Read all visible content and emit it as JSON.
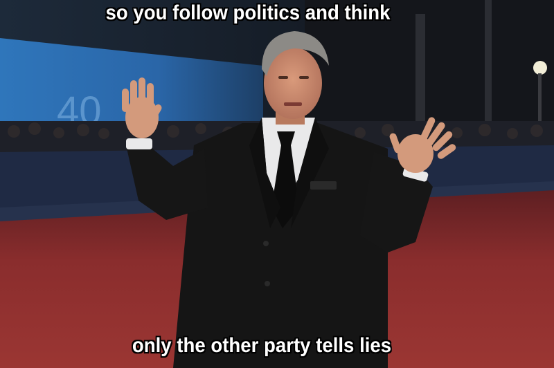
{
  "meme": {
    "top_text": "so you follow politics and think",
    "bottom_text": "only the other party tells lies"
  },
  "photo": {
    "subject": "man in black suit with raised open hands",
    "background_sign_text": "40",
    "colors": {
      "carpet": "#8e2f2e",
      "banner": "#2a6fb5",
      "suit": "#141414",
      "shirt": "#e9e9ea",
      "skin": "#c98a6c",
      "hair": "#8c8a86"
    }
  }
}
